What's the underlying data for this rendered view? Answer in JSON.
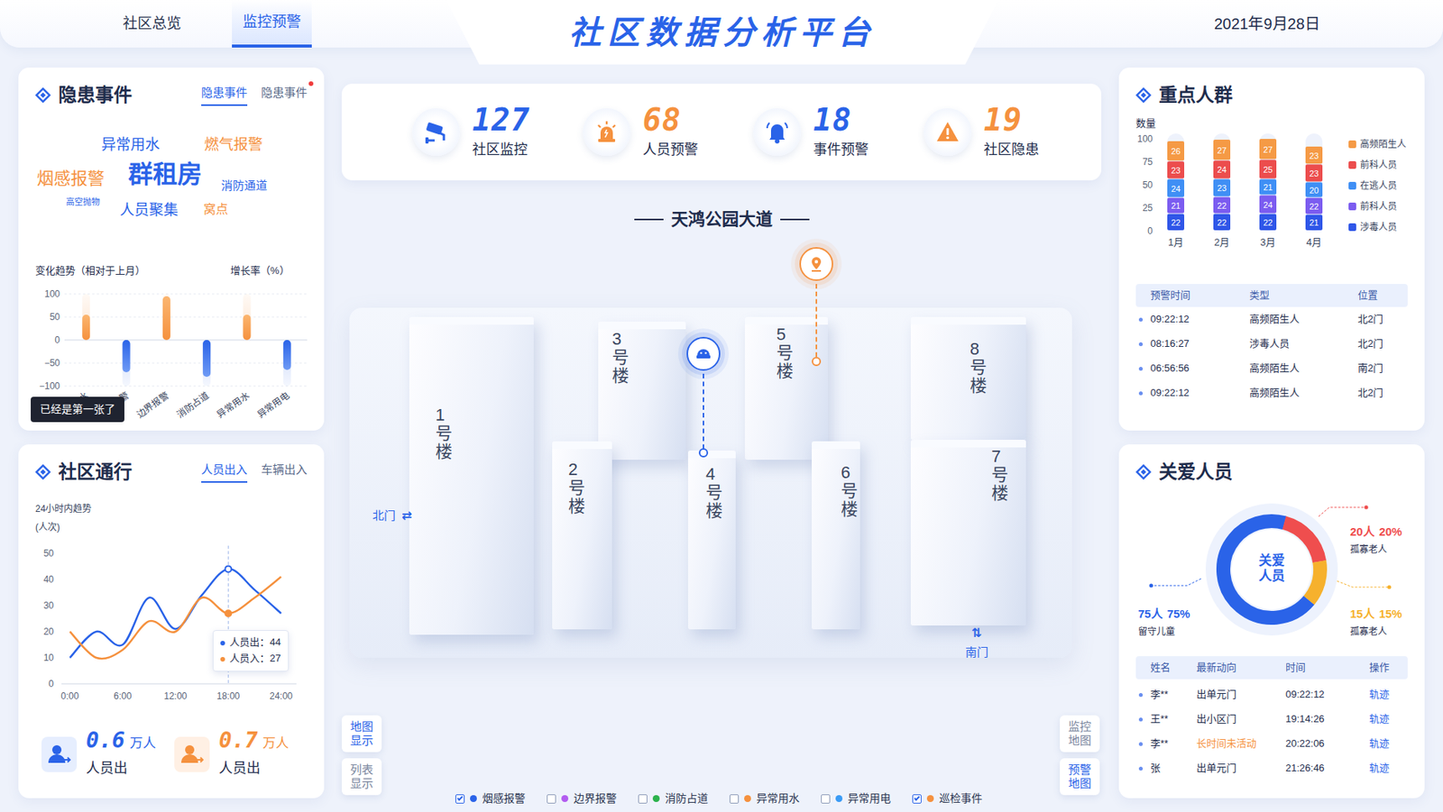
{
  "header": {
    "tabs": [
      {
        "label": "社区总览",
        "selected": false
      },
      {
        "label": "监控预警",
        "selected": true
      }
    ],
    "title": "社区数据分析平台",
    "date": "2021年9月28日"
  },
  "stats": [
    {
      "value": "127",
      "label": "社区监控",
      "color": "#2a63e8"
    },
    {
      "value": "68",
      "label": "人员预警",
      "color": "#f5913e"
    },
    {
      "value": "18",
      "label": "事件预警",
      "color": "#2a63e8"
    },
    {
      "value": "19",
      "label": "社区隐患",
      "color": "#f5913e"
    }
  ],
  "hazards": {
    "title": "隐患事件",
    "tabs": [
      {
        "label": "隐患事件",
        "selected": true
      },
      {
        "label": "隐患事件",
        "selected": false,
        "badge": true
      }
    ],
    "cloud": [
      {
        "text": "异常用水",
        "color": "#2a63e8"
      },
      {
        "text": "燃气报警",
        "color": "#f5913e"
      },
      {
        "text": "烟感报警",
        "color": "#f5913e"
      },
      {
        "text": "群租房",
        "color": "#2a63e8"
      },
      {
        "text": "消防通道",
        "color": "#2a63e8"
      },
      {
        "text": "高空抛物",
        "color": "#2a63e8"
      },
      {
        "text": "人员聚集",
        "color": "#2a63e8"
      },
      {
        "text": "窝点",
        "color": "#f5913e"
      }
    ],
    "chart": {
      "title": "变化趋势（相对于上月）",
      "unit": "增长率（%）",
      "ticks": [
        "100",
        "50",
        "0",
        "−50",
        "−100"
      ],
      "categories": [
        "水",
        "警",
        "边界报警",
        "消防占道",
        "异常用水",
        "异常用电"
      ],
      "values": [
        55,
        -70,
        95,
        -80,
        55,
        -65
      ]
    },
    "tooltip": "已经是第一张了"
  },
  "traffic": {
    "title": "社区通行",
    "tabs": [
      {
        "label": "人员出入",
        "selected": true
      },
      {
        "label": "车辆出入",
        "selected": false
      }
    ],
    "subtitle": "24小时内趋势",
    "unit": "(人次)",
    "yTicks": [
      "50",
      "40",
      "30",
      "20",
      "10",
      "0"
    ],
    "xTicks": [
      "0:00",
      "6:00",
      "12:00",
      "18:00",
      "24:00"
    ],
    "hours": [
      0,
      3,
      6,
      9,
      12,
      15,
      18,
      21,
      24
    ],
    "series": [
      {
        "name": "人员出",
        "color": "#2a63e8",
        "values": [
          10,
          20,
          15,
          33,
          21,
          34,
          44,
          36,
          27
        ]
      },
      {
        "name": "人员入",
        "color": "#f5913e",
        "values": [
          20,
          10,
          13,
          24,
          20,
          33,
          27,
          33,
          41
        ]
      }
    ],
    "tooltip": {
      "at": 18,
      "rows": [
        {
          "text": "人员出：44",
          "color": "#2a63e8"
        },
        {
          "text": "人员入：27",
          "color": "#f5913e"
        }
      ]
    },
    "summary": [
      {
        "value": "0.6",
        "unit": "万人",
        "label": "人员出",
        "color": "#2a63e8"
      },
      {
        "value": "0.7",
        "unit": "万人",
        "label": "人员出",
        "color": "#f5913e"
      }
    ]
  },
  "keyGroups": {
    "title": "重点人群",
    "axisLabel": "数量",
    "yTicks": [
      "100",
      "75",
      "50",
      "25",
      "0"
    ],
    "months": [
      "1月",
      "2月",
      "3月",
      "4月"
    ],
    "series": [
      {
        "name": "高频陌生人",
        "color": "#f59a45",
        "values": [
          26,
          27,
          27,
          23
        ]
      },
      {
        "name": "前科人员",
        "color": "#ec4d4d",
        "values": [
          23,
          24,
          25,
          23
        ]
      },
      {
        "name": "在逃人员",
        "color": "#3f8ff5",
        "values": [
          24,
          23,
          21,
          20
        ]
      },
      {
        "name": "前科人员",
        "color": "#7b5cf0",
        "values": [
          21,
          22,
          24,
          22
        ]
      },
      {
        "name": "涉毒人员",
        "color": "#2f56e8",
        "values": [
          22,
          22,
          22,
          21
        ]
      }
    ],
    "table": {
      "columns": [
        "预警时间",
        "类型",
        "位置"
      ],
      "rows": [
        [
          "09:22:12",
          "高频陌生人",
          "北2门"
        ],
        [
          "08:16:27",
          "涉毒人员",
          "北2门"
        ],
        [
          "06:56:56",
          "高频陌生人",
          "南2门"
        ],
        [
          "09:22:12",
          "高频陌生人",
          "北2门"
        ]
      ]
    }
  },
  "care": {
    "title": "关爱人员",
    "center": "关爱人员",
    "segments": [
      {
        "count": "75人",
        "percent": "75%",
        "label": "留守儿童",
        "value": 75,
        "color": "#2a63e8"
      },
      {
        "count": "20人",
        "percent": "20%",
        "label": "孤寡老人",
        "value": 20,
        "color": "#ef4e4e"
      },
      {
        "count": "15人",
        "percent": "15%",
        "label": "孤寡老人",
        "value": 15,
        "color": "#f6b12d"
      }
    ],
    "table": {
      "columns": [
        "姓名",
        "最新动向",
        "时间",
        "操作"
      ],
      "rows": [
        {
          "name": "李**",
          "move": "出单元门",
          "time": "09:22:12",
          "action": "轨迹",
          "alert": false
        },
        {
          "name": "王**",
          "move": "出小区门",
          "time": "19:14:26",
          "action": "轨迹",
          "alert": false
        },
        {
          "name": "李**",
          "move": "长时间未活动",
          "time": "20:22:06",
          "action": "轨迹",
          "alert": true
        },
        {
          "name": "张",
          "move": "出单元门",
          "time": "21:26:46",
          "action": "轨迹",
          "alert": false
        }
      ]
    }
  },
  "map": {
    "road": "天鸿公园大道",
    "gates": [
      {
        "label": "北门",
        "icon": "⇄"
      },
      {
        "label": "南门",
        "icon": "⇅"
      }
    ],
    "buildings": [
      "1号楼",
      "2号楼",
      "3号楼",
      "4号楼",
      "5号楼",
      "6号楼",
      "8号楼",
      "7号楼"
    ],
    "pins": [
      {
        "kind": "monitor",
        "color": "#2a63e8"
      },
      {
        "kind": "location",
        "color": "#f5913e"
      }
    ],
    "viewButtons": [
      {
        "label": "地图显示",
        "selected": true
      },
      {
        "label": "列表显示",
        "selected": false
      }
    ],
    "mapButtons": [
      {
        "label": "监控地图",
        "selected": false
      },
      {
        "label": "预警地图",
        "selected": true
      }
    ],
    "legend": [
      {
        "label": "烟感报警",
        "checked": true,
        "color": "#2a63e8"
      },
      {
        "label": "边界报警",
        "checked": false,
        "color": "#b25cf0"
      },
      {
        "label": "消防占道",
        "checked": false,
        "color": "#2bb24c"
      },
      {
        "label": "异常用水",
        "checked": false,
        "color": "#f5913e"
      },
      {
        "label": "异常用电",
        "checked": false,
        "color": "#3a9bf5"
      },
      {
        "label": "巡检事件",
        "checked": true,
        "color": "#f5913e"
      }
    ]
  }
}
